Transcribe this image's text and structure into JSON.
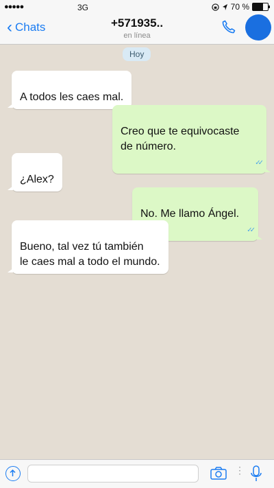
{
  "status_bar": {
    "signal": "●●●●●",
    "network": "3G",
    "battery_percent": "70 %",
    "battery_level": 0.7
  },
  "header": {
    "back_label": "Chats",
    "contact_name": "+571935..",
    "contact_status": "en línea"
  },
  "chat": {
    "date_label": "Hoy",
    "messages": [
      {
        "direction": "in",
        "text": "A todos les caes mal."
      },
      {
        "direction": "out",
        "text": "Creo que te equivocaste\nde número."
      },
      {
        "direction": "in",
        "text": "¿Alex?"
      },
      {
        "direction": "out",
        "text": "No. Me llamo Ángel."
      },
      {
        "direction": "in",
        "text": "Bueno, tal vez tú también\nle caes mal a todo el mundo."
      }
    ]
  },
  "composer": {
    "placeholder": ""
  },
  "icons": [
    "chevron-left-icon",
    "phone-icon",
    "upload-icon",
    "camera-icon",
    "microphone-icon"
  ],
  "colors": {
    "accent": "#1a7cf2",
    "outgoing_bubble": "#dcf8c6",
    "incoming_bubble": "#ffffff",
    "read_ticks": "#4fa6e8",
    "wallpaper": "#e4ddd3"
  }
}
